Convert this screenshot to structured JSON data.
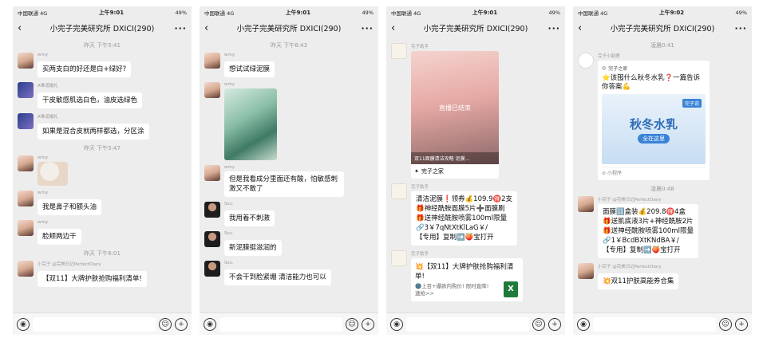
{
  "status_bar": {
    "carrier": "中国联通 4G",
    "right": "49%"
  },
  "phones": [
    {
      "status_time": "上午9:01",
      "title": "小完子完美研究所 DXICI(290)",
      "times": [
        "昨天 下午5:41",
        "昨天 下午5:47",
        "昨天 下午6:01"
      ],
      "messages": [
        {
          "name": "wmy",
          "text": "买两支白的好还是白+绿好?"
        },
        {
          "name": "A唯诺婚礼",
          "text": "干皮敏感肌选白色，油皮选绿色"
        },
        {
          "name": "A唯诺婚礼",
          "text": "如果是混合皮就两样都选，分区涂"
        },
        {
          "name": "wmy",
          "text": ""
        },
        {
          "name": "wmy",
          "text": "我是鼻子和额头油"
        },
        {
          "name": "wmy",
          "text": "脸颊两边干"
        },
        {
          "name": "小完子 @完美日记PerfectDiary",
          "text": "【双11】大牌护肤抢购福利清单!"
        }
      ]
    },
    {
      "status_time": "上午9:01",
      "title": "小完子完美研究所 DXICI(290)",
      "times": [
        "昨天 下午6:43"
      ],
      "messages": [
        {
          "name": "wmy",
          "text": "想试试绿泥膜"
        },
        {
          "name": "wmy",
          "text": ""
        },
        {
          "name": "wmy",
          "text": "但是我看成分里面还有酸，怕敏感刺激又不敢了"
        },
        {
          "name": "Ssu.",
          "text": "我用着不刺激"
        },
        {
          "name": "Ssu.",
          "text": "新泥膜挺滋润的"
        },
        {
          "name": "Ssu.",
          "text": "不会干到脸紧绷 清洁能力也可以"
        }
      ]
    },
    {
      "status_time": "上午9:01",
      "title": "小完子完美研究所 DXICI(290)",
      "messages": [
        {
          "name": "完子助手",
          "video_status": "直播已结束",
          "video_caption": "双11面膜清洁攻略 泥膜...",
          "video_source": "完子之家"
        },
        {
          "name": "完子助手",
          "text": "清洁泥膜❗领券💰109.9🉐2支\n🎁神经酰胺面膜5片➕面膜刷\n🎁送神经酰胺喷雾100ml限量\n🔗3￥7qNtXtKlLaG￥/\n【专用】复制➡️🍑宝打开"
        },
        {
          "name": "完子助手",
          "text": "💥【双11】大牌护肤抢购福利清单!",
          "sub": "🌚上百+爆款内购价! 限时直降! 速抢>>"
        }
      ]
    },
    {
      "status_time": "上午9:02",
      "title": "小完子完美研究所 DXICI(290)",
      "times": [
        "凌晨0:41",
        "凌晨0:48"
      ],
      "messages": [
        {
          "name": "完子小助理",
          "mini_source": "完子之家",
          "mini_desc": "⭐该囤什么秋冬水乳❓一篇告诉你答案💪",
          "mini_big": "秋冬水乳",
          "mini_ribbon": "全在这里",
          "mini_tag": "完子说",
          "mini_foot": "小程序"
        },
        {
          "name": "小完子 @完美日记PerfectDiary",
          "text": "面膜🔢盒装💰209.8🉐4盒\n🎁送肌底液3片+神经酰胺2片\n🎁送神经酰胺喷雾100ml限量\n🔗1￥BcdBXtKNdBA￥/\n【专用】复制➡️🍑宝打开"
        },
        {
          "name": "小完子 @完美日记PerfectDiary",
          "text": "💥双11护肤高能券合集"
        }
      ]
    }
  ],
  "colors": {
    "chat_bg": "#ededed",
    "bubble": "#ffffff",
    "meta_text": "#9a9a9a"
  },
  "icons": [
    "back-arrow-icon",
    "more-icon",
    "voice-icon",
    "emoji-icon",
    "plus-icon",
    "excel-icon"
  ]
}
